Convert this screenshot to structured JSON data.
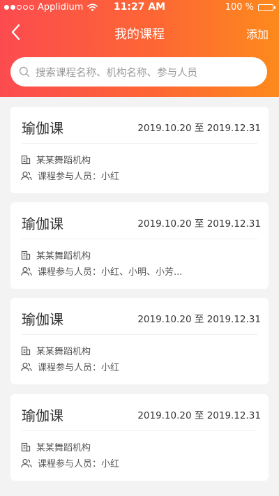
{
  "status_bar": {
    "carrier": "Applidium",
    "time": "11:27 AM",
    "battery": "100 %",
    "signal_bars_filled": 2,
    "signal_bars_total": 5
  },
  "nav": {
    "title": "我的课程",
    "action": "添加",
    "back_icon": "chevron-left-icon"
  },
  "search": {
    "placeholder": "搜索课程名称、机构名称、参与人员",
    "icon": "search-icon"
  },
  "colors": {
    "header_gradient_start": "#fc4b4f",
    "header_gradient_end": "#fd8a1d",
    "page_background": "#f3f3f3",
    "card_background": "#ffffff"
  },
  "courses": [
    {
      "title": "瑜伽课",
      "date": "2019.10.20 至 2019.12.31",
      "org": "某某舞蹈机构",
      "members": "课程参与人员：小红"
    },
    {
      "title": "瑜伽课",
      "date": "2019.10.20 至 2019.12.31",
      "org": "某某舞蹈机构",
      "members": "课程参与人员：小红、小明、小芳..."
    },
    {
      "title": "瑜伽课",
      "date": "2019.10.20 至 2019.12.31",
      "org": "某某舞蹈机构",
      "members": "课程参与人员：小红"
    },
    {
      "title": "瑜伽课",
      "date": "2019.10.20 至 2019.12.31",
      "org": "某某舞蹈机构",
      "members": "课程参与人员：小红"
    }
  ]
}
